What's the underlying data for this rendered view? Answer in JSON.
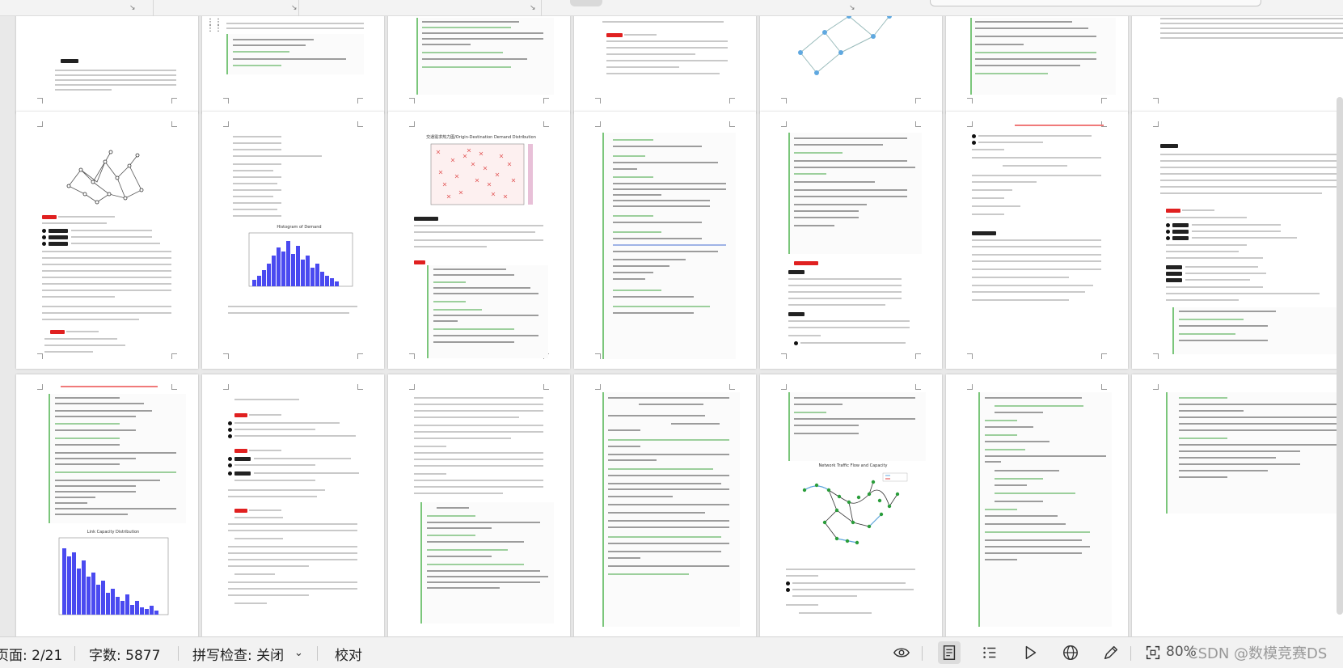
{
  "status_bar": {
    "page": "页面: 2/21",
    "word_count": "字数: 5877",
    "spell_check": "拼写检查: 关闭",
    "proofread": "校对",
    "zoom": "80%",
    "watermark": "CSDN @数模竞赛DS"
  },
  "icons": {
    "spell_check_dropdown": "chevron-down-icon",
    "eye": "eye-icon",
    "page_view": "page-view-icon",
    "outline": "outline-icon",
    "play": "play-icon",
    "web": "globe-icon",
    "pen": "pen-icon",
    "focus": "focus-icon"
  },
  "pages": {
    "p8_chart_title": "交通需求热力图/Origin-Destination Demand Distribution",
    "p9_chart_title": "Histogram of Demand",
    "p15_chart_title": "Link Capacity Distribution",
    "p19_chart_title": "Network Traffic Flow and Capacity",
    "p1_heading": "问题一",
    "p14_heading": "问题三"
  },
  "colors": {
    "accent_red": "#e02020",
    "code_green": "#7bc67b",
    "chart_blue": "#4a4af0",
    "node_blue": "#5fa8e0"
  }
}
